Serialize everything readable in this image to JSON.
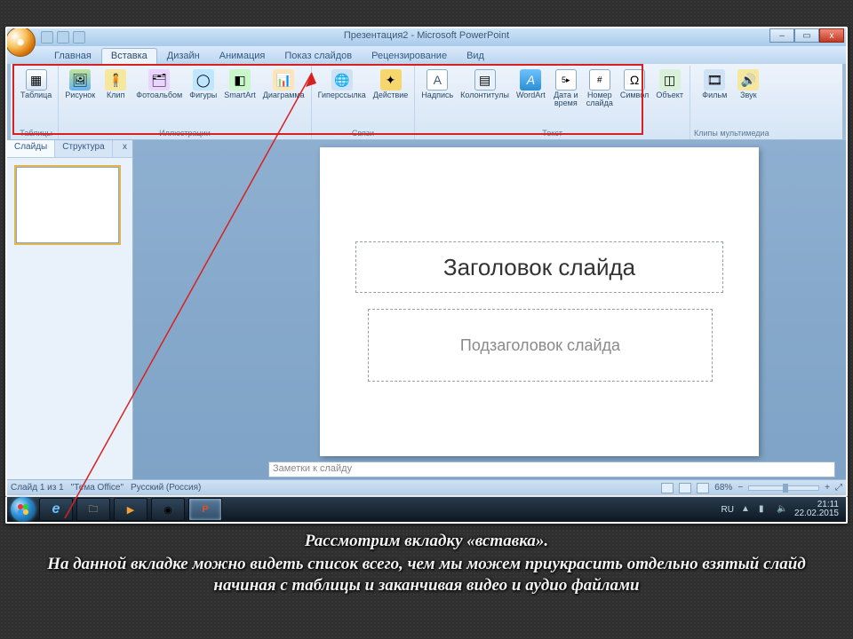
{
  "window": {
    "title": "Презентация2 - Microsoft PowerPoint",
    "min": "–",
    "max": "▭",
    "close": "x"
  },
  "tabs": {
    "home": "Главная",
    "insert": "Вставка",
    "design": "Дизайн",
    "anim": "Анимация",
    "slideshow": "Показ слайдов",
    "review": "Рецензирование",
    "view": "Вид"
  },
  "ribbon": {
    "groups": {
      "tables": "Таблицы",
      "illustrations": "Иллюстрации",
      "links": "Связи",
      "text": "Текст",
      "media": "Клипы мультимедиа"
    },
    "btn": {
      "table": "Таблица",
      "picture": "Рисунок",
      "clip": "Клип",
      "album": "Фотоальбом",
      "shapes": "Фигуры",
      "smartart": "SmartArt",
      "chart": "Диаграмма",
      "hyperlink": "Гиперссылка",
      "action": "Действие",
      "textbox": "Надпись",
      "headerfooter": "Колонтитулы",
      "wordart": "WordArt",
      "datetime": "Дата и\nвремя",
      "slidenum": "Номер\nслайда",
      "symbol": "Символ",
      "object": "Объект",
      "movie": "Фильм",
      "sound": "Звук"
    }
  },
  "leftpanel": {
    "slides": "Слайды",
    "outline": "Структура",
    "close": "x"
  },
  "slide": {
    "title_placeholder": "Заголовок слайда",
    "subtitle_placeholder": "Подзаголовок слайда"
  },
  "notes": {
    "placeholder": "Заметки к слайду"
  },
  "status": {
    "slidecount": "Слайд 1 из 1",
    "theme": "\"Тема Office\"",
    "lang": "Русский (Россия)",
    "zoom": "68%",
    "fit": "⤢"
  },
  "taskbar": {
    "lang": "RU",
    "time": "21:11",
    "date": "22.02.2015"
  },
  "caption": {
    "line1": "Рассмотрим вкладку «вставка».",
    "line2": "На данной вкладке можно видеть список всего, чем мы можем приукрасить отдельно взятый слайд начиная с таблицы и заканчивая видео и аудио файлами"
  },
  "colors": {
    "accent": "#d92020",
    "ribbon_bg": "#edf3fb"
  }
}
